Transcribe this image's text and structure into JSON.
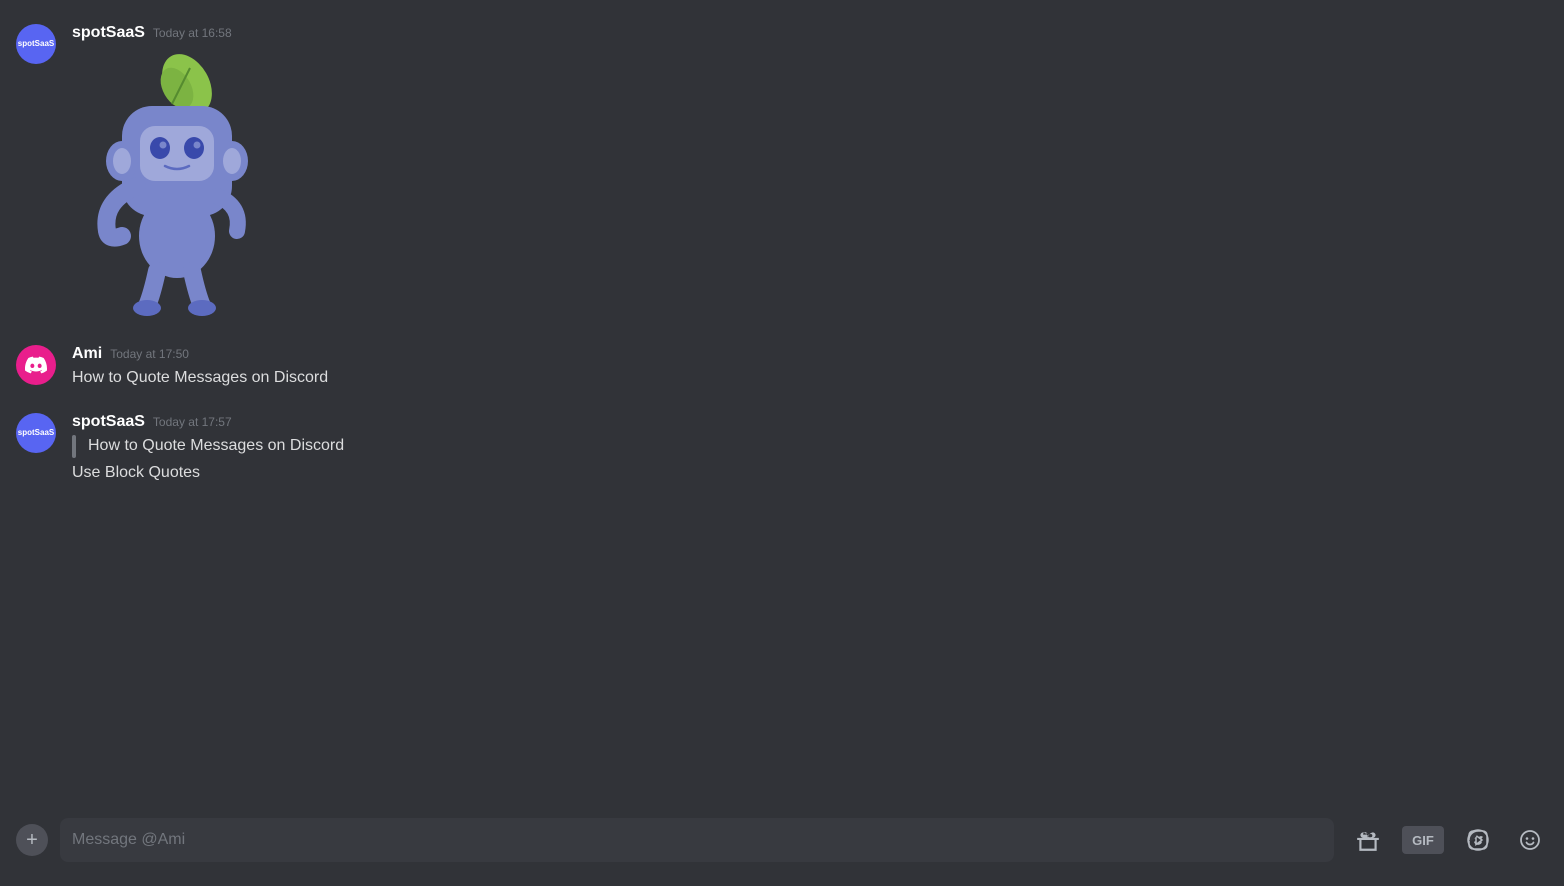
{
  "messages": [
    {
      "id": "msg1",
      "username": "spotSaaS",
      "timestamp": "Today at 16:58",
      "avatar_type": "spotsaas",
      "avatar_label": "spotSaaS",
      "has_mascot": true,
      "texts": []
    },
    {
      "id": "msg2",
      "username": "Ami",
      "timestamp": "Today at 17:50",
      "avatar_type": "ami",
      "avatar_label": "Ami",
      "has_mascot": false,
      "texts": [
        {
          "type": "plain",
          "content": "How to Quote Messages on Discord"
        }
      ]
    },
    {
      "id": "msg3",
      "username": "spotSaaS",
      "timestamp": "Today at 17:57",
      "avatar_type": "spotsaas",
      "avatar_label": "spotSaaS",
      "has_mascot": false,
      "texts": [
        {
          "type": "blockquote",
          "content": "How to Quote Messages on Discord"
        },
        {
          "type": "plain",
          "content": "Use Block Quotes"
        }
      ]
    }
  ],
  "input": {
    "placeholder": "Message @Ami"
  },
  "buttons": {
    "add_label": "+",
    "gif_label": "GIF"
  }
}
